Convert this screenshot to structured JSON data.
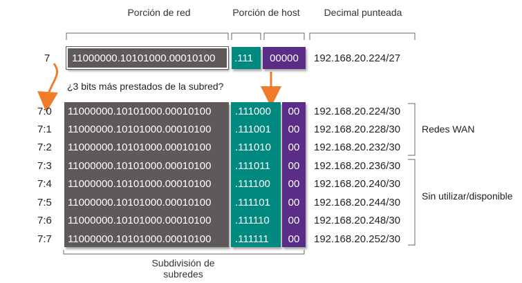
{
  "headers": {
    "network_portion": "Porción de red",
    "host_portion": "Porción de host",
    "dotted_decimal": "Decimal punteada"
  },
  "top_row": {
    "label": "7",
    "network_bits": "11000000.10101000.00010100",
    "host_bits": ".111",
    "remaining_bits": "00000",
    "address": "192.168.20.224/27"
  },
  "question": "¿3 bits más prestados de la subred?",
  "rows": [
    {
      "label": "7:0",
      "network_bits": "11000000.10101000.00010100",
      "subnet_bits": ".111000",
      "host_bits": "00",
      "address": "192.168.20.224/30"
    },
    {
      "label": "7:1",
      "network_bits": "11000000.10101000.00010100",
      "subnet_bits": ".111001",
      "host_bits": "00",
      "address": "192.168.20.228/30"
    },
    {
      "label": "7:2",
      "network_bits": "11000000.10101000.00010100",
      "subnet_bits": ".111010",
      "host_bits": "00",
      "address": "192.168.20.232/30"
    },
    {
      "label": "7:3",
      "network_bits": "11000000.10101000.00010100",
      "subnet_bits": ".111011",
      "host_bits": "00",
      "address": "192.168.20.236/30"
    },
    {
      "label": "7:4",
      "network_bits": "11000000.10101000.00010100",
      "subnet_bits": ".111100",
      "host_bits": "00",
      "address": "192.168.20.240/30"
    },
    {
      "label": "7:5",
      "network_bits": "11000000.10101000.00010100",
      "subnet_bits": ".111101",
      "host_bits": "00",
      "address": "192.168.20.244/30"
    },
    {
      "label": "7:6",
      "network_bits": "11000000.10101000.00010100",
      "subnet_bits": ".111110",
      "host_bits": "00",
      "address": "192.168.20.248/30"
    },
    {
      "label": "7:7",
      "network_bits": "11000000.10101000.00010100",
      "subnet_bits": ".111111",
      "host_bits": "00",
      "address": "192.168.20.252/30"
    }
  ],
  "groups": {
    "wan": "Redes WAN",
    "unused": "Sin utilizar/disponible"
  },
  "footer": "Subdivisión de subredes",
  "colors": {
    "network": "#5f5a5a",
    "subnet": "#00897f",
    "host": "#5a2d86",
    "arrow": "#f07c2a"
  }
}
